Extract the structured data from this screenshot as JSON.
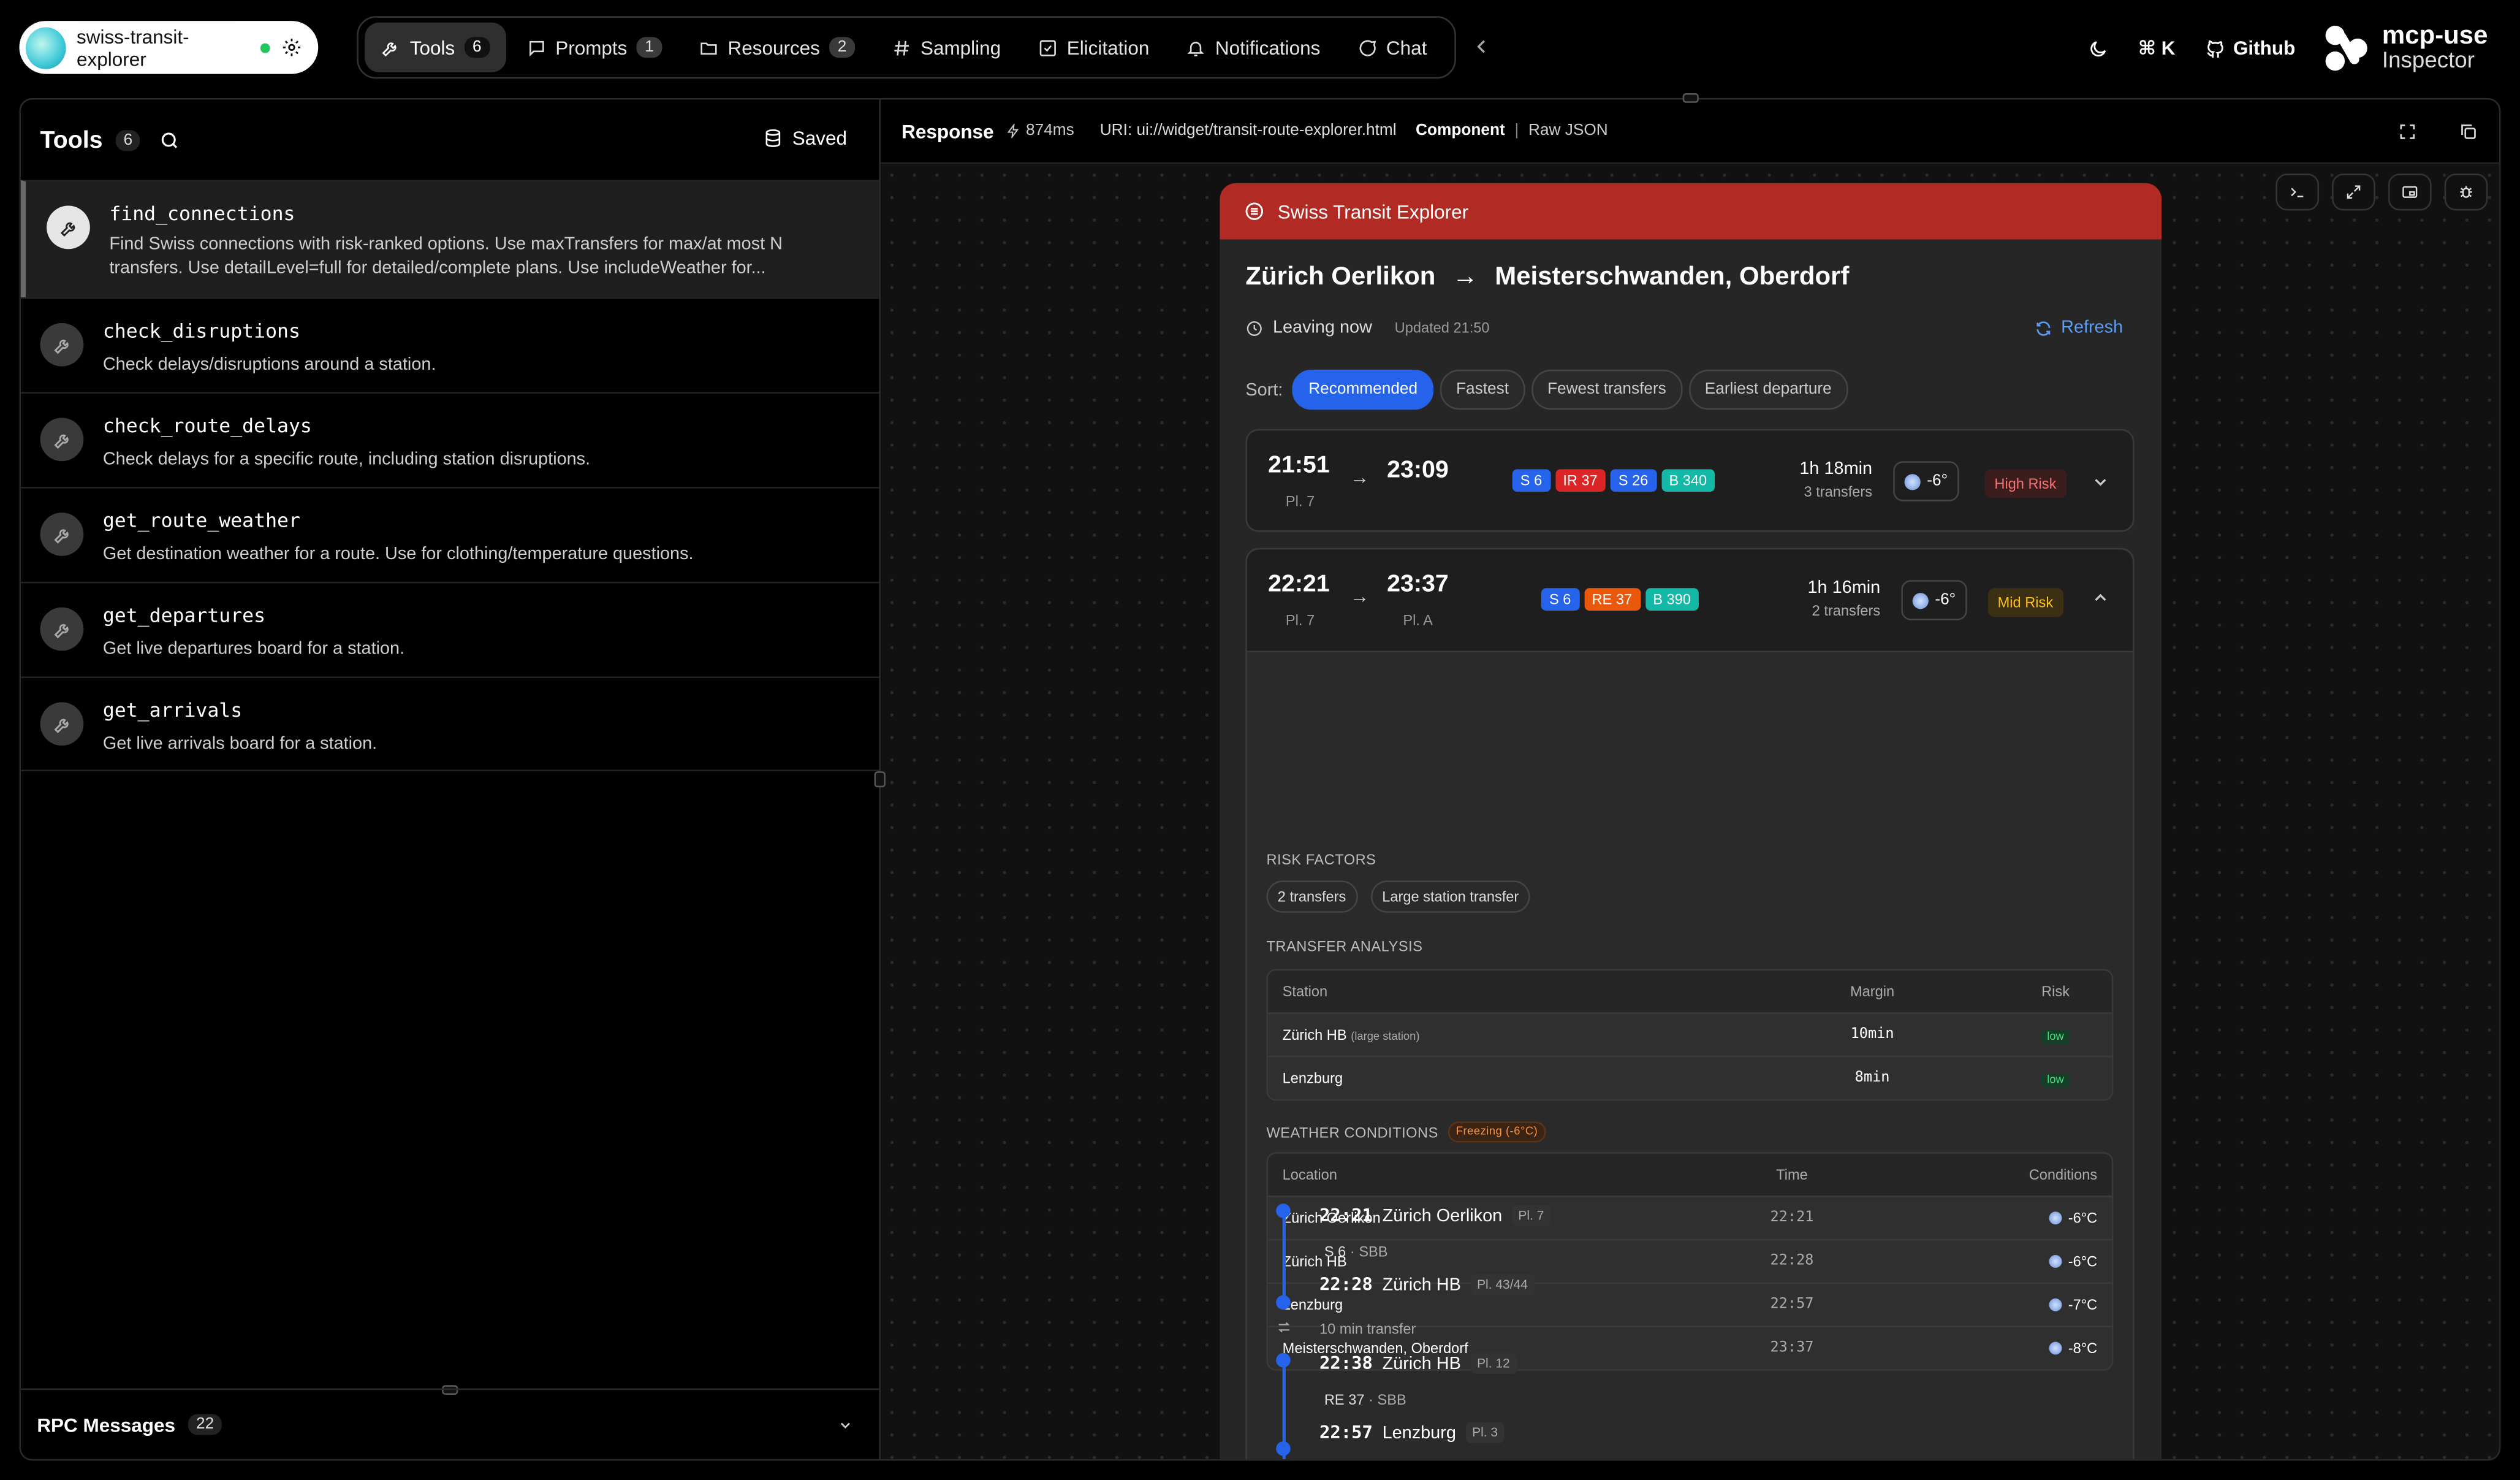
{
  "server": {
    "name": "swiss-transit-explorer"
  },
  "nav": {
    "tabs": [
      {
        "label": "Tools",
        "count": "6"
      },
      {
        "label": "Prompts",
        "count": "1"
      },
      {
        "label": "Resources",
        "count": "2"
      },
      {
        "label": "Sampling"
      },
      {
        "label": "Elicitation"
      },
      {
        "label": "Notifications"
      },
      {
        "label": "Chat"
      }
    ],
    "shortcut": "⌘ K",
    "github": "Github",
    "brand_top": "mcp-use",
    "brand_bottom": "Inspector"
  },
  "tools_panel": {
    "title": "Tools",
    "count": "6",
    "saved": "Saved",
    "tools": [
      {
        "name": "find_connections",
        "desc": "Find Swiss connections with risk-ranked options. Use maxTransfers for max/at most N transfers. Use detailLevel=full for detailed/complete plans. Use includeWeather for..."
      },
      {
        "name": "check_disruptions",
        "desc": "Check delays/disruptions around a station."
      },
      {
        "name": "check_route_delays",
        "desc": "Check delays for a specific route, including station disruptions."
      },
      {
        "name": "get_route_weather",
        "desc": "Get destination weather for a route. Use for clothing/temperature questions."
      },
      {
        "name": "get_departures",
        "desc": "Get live departures board for a station."
      },
      {
        "name": "get_arrivals",
        "desc": "Get live arrivals board for a station."
      }
    ],
    "rpc_label": "RPC Messages",
    "rpc_count": "22"
  },
  "response": {
    "label": "Response",
    "timing": "874ms",
    "uri": "URI: ui://widget/transit-route-explorer.html",
    "view_component": "Component",
    "separator": "|",
    "view_raw": "Raw JSON"
  },
  "widget": {
    "app_title": "Swiss Transit Explorer",
    "from": "Zürich Oerlikon",
    "arrow": "→",
    "to": "Meisterschwanden, Oberdorf",
    "leaving": "Leaving now",
    "updated": "Updated 21:50",
    "refresh": "Refresh",
    "sort_label": "Sort:",
    "sort_options": [
      "Recommended",
      "Fastest",
      "Fewest transfers",
      "Earliest departure"
    ],
    "connections": [
      {
        "dep": "21:51",
        "dep_platform": "Pl. 7",
        "arrow": "→",
        "arr": "23:09",
        "arr_platform": "",
        "lines": [
          {
            "label": "S 6",
            "color": "#2563eb"
          },
          {
            "label": "IR 37",
            "color": "#dc2626"
          },
          {
            "label": "S 26",
            "color": "#2563eb"
          },
          {
            "label": "B 340",
            "color": "#14b8a6"
          }
        ],
        "duration": "1h 18min",
        "transfers": "3 transfers",
        "temp": "-6°",
        "risk": "High Risk",
        "risk_color": "#f87171",
        "risk_bg": "#3b1d1d"
      },
      {
        "dep": "22:21",
        "dep_platform": "Pl. 7",
        "arrow": "→",
        "arr": "23:37",
        "arr_platform": "Pl. A",
        "lines": [
          {
            "label": "S 6",
            "color": "#2563eb"
          },
          {
            "label": "RE 37",
            "color": "#ea580c"
          },
          {
            "label": "B 390",
            "color": "#14b8a6"
          }
        ],
        "duration": "1h 16min",
        "transfers": "2 transfers",
        "temp": "-6°",
        "risk": "Mid Risk",
        "risk_color": "#fbbf24",
        "risk_bg": "#3b2f14"
      }
    ],
    "risk_factors_title": "RISK FACTORS",
    "risk_factors": [
      "2 transfers",
      "Large station transfer"
    ],
    "transfer_title": "TRANSFER ANALYSIS",
    "transfer_headers": [
      "Station",
      "Margin",
      "Risk"
    ],
    "transfers": [
      {
        "station": "Zürich HB",
        "note": "(large station)",
        "margin": "10min",
        "risk": "low"
      },
      {
        "station": "Lenzburg",
        "note": "",
        "margin": "8min",
        "risk": "low"
      }
    ],
    "weather_title": "WEATHER CONDITIONS",
    "weather_badge": "Freezing (-6°C)",
    "weather_headers": [
      "Location",
      "Time",
      "Conditions"
    ],
    "weather": [
      {
        "location": "Zürich Oerlikon",
        "time": "22:21",
        "temp": "-6°C"
      },
      {
        "location": "Zürich HB",
        "time": "22:28",
        "temp": "-6°C"
      },
      {
        "location": "Lenzburg",
        "time": "22:57",
        "temp": "-7°C"
      },
      {
        "location": "Meisterschwanden, Oberdorf",
        "time": "23:37",
        "temp": "-8°C"
      }
    ],
    "timeline": [
      {
        "time": "22:21",
        "station": "Zürich Oerlikon",
        "platform": "Pl. 7"
      },
      {
        "line": "S 6",
        "operator": "· SBB"
      },
      {
        "time": "22:28",
        "station": "Zürich HB",
        "platform": "Pl. 43/44"
      },
      {
        "transfer": "10 min transfer"
      },
      {
        "time": "22:38",
        "station": "Zürich HB",
        "platform": "Pl. 12"
      },
      {
        "line": "RE 37",
        "operator": "· SBB"
      },
      {
        "time": "22:57",
        "station": "Lenzburg",
        "platform": "Pl. 3"
      }
    ]
  }
}
